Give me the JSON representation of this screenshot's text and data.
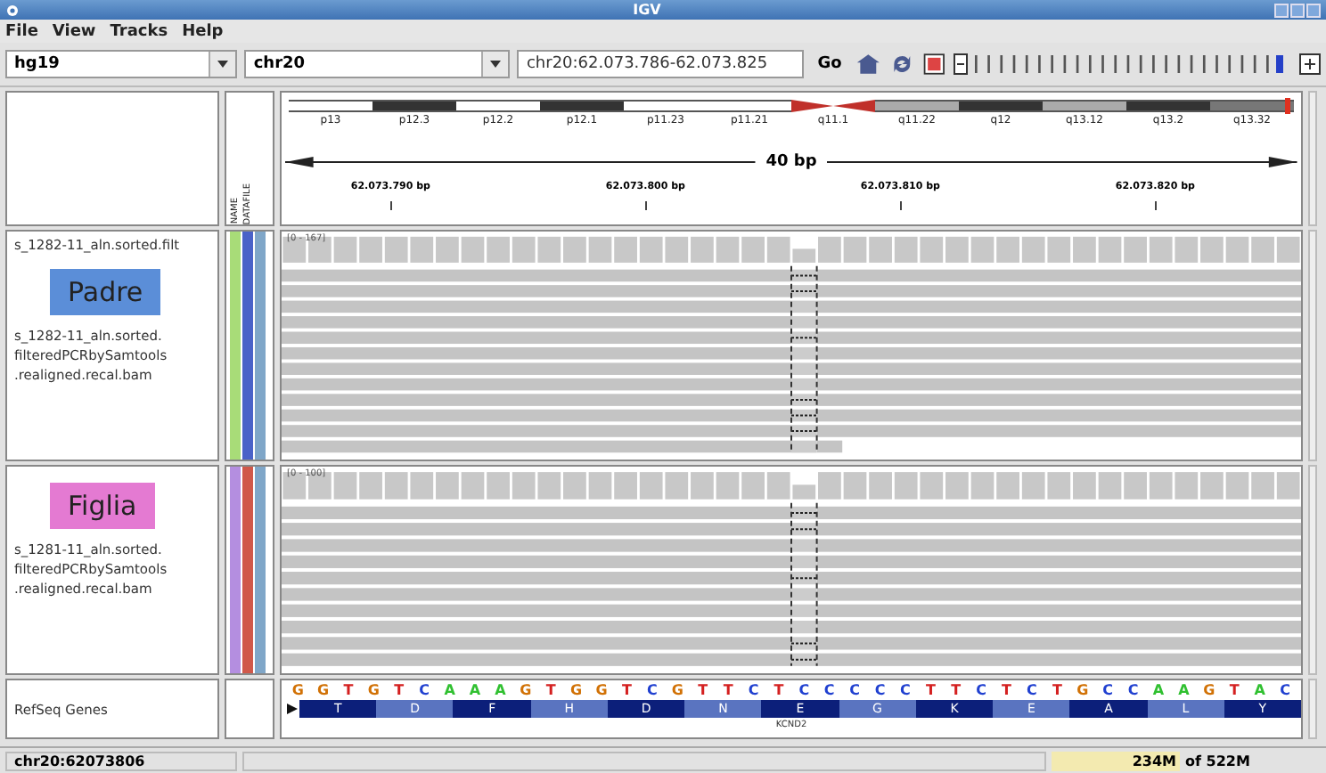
{
  "window": {
    "title": "IGV"
  },
  "menu": [
    "File",
    "View",
    "Tracks",
    "Help"
  ],
  "toolbar": {
    "genome": "hg19",
    "chromosome": "chr20",
    "locus": "chr20:62.073.786-62.073.825",
    "go": "Go",
    "zoom": {
      "level": 0.97
    }
  },
  "ideogram": {
    "bands": [
      {
        "label": "p13",
        "kind": "light"
      },
      {
        "label": "p12.3",
        "kind": "dark"
      },
      {
        "label": "p12.2",
        "kind": "light"
      },
      {
        "label": "p12.1",
        "kind": "dark"
      },
      {
        "label": "p11.23",
        "kind": "light"
      },
      {
        "label": "p11.21",
        "kind": "light"
      },
      {
        "label": "q11.1",
        "kind": "centromere"
      },
      {
        "label": "q11.22",
        "kind": "grey"
      },
      {
        "label": "q12",
        "kind": "dark"
      },
      {
        "label": "q13.12",
        "kind": "grey"
      },
      {
        "label": "q13.2",
        "kind": "dark"
      },
      {
        "label": "q13.32",
        "kind": "mid"
      }
    ]
  },
  "ruler": {
    "span": "40 bp",
    "ticks": [
      "62.073.790 bp",
      "62.073.800 bp",
      "62.073.810 bp",
      "62.073.820 bp"
    ]
  },
  "attribute_headers": [
    "NAME",
    "DATAFILE"
  ],
  "tracks": [
    {
      "name": "s_1282-11_aln.sorted.filt",
      "sample": "Padre",
      "color": "#5b8ed8",
      "file": [
        "s_1282-11_aln.sorted.",
        "filteredPCRbySamtools",
        ".realigned.recal.bam"
      ],
      "range": "[0 - 167]",
      "attributes": [
        {
          "color": "#a8dc78"
        },
        {
          "color": "#4a62c8"
        },
        {
          "color": "#7fa6c8"
        }
      ]
    },
    {
      "sample": "Figlia",
      "color": "#e47ad2",
      "file": [
        "s_1281-11_aln.sorted.",
        "filteredPCRbySamtools",
        ".realigned.recal.bam"
      ],
      "range": "[0 - 100]",
      "attributes": [
        {
          "color": "#b48ee0"
        },
        {
          "color": "#d0584a"
        },
        {
          "color": "#7fa6c8"
        }
      ]
    }
  ],
  "refseq": {
    "name": "RefSeq Genes",
    "gene": "KCND2",
    "sequence": [
      {
        "base": "G",
        "color": "#d17105"
      },
      {
        "base": "G",
        "color": "#d17105"
      },
      {
        "base": "T",
        "color": "#d42020"
      },
      {
        "base": "G",
        "color": "#d17105"
      },
      {
        "base": "T",
        "color": "#d42020"
      },
      {
        "base": "C",
        "color": "#2040d0"
      },
      {
        "base": "A",
        "color": "#30c030"
      },
      {
        "base": "A",
        "color": "#30c030"
      },
      {
        "base": "A",
        "color": "#30c030"
      },
      {
        "base": "G",
        "color": "#d17105"
      },
      {
        "base": "T",
        "color": "#d42020"
      },
      {
        "base": "G",
        "color": "#d17105"
      },
      {
        "base": "G",
        "color": "#d17105"
      },
      {
        "base": "T",
        "color": "#d42020"
      },
      {
        "base": "C",
        "color": "#2040d0"
      },
      {
        "base": "G",
        "color": "#d17105"
      },
      {
        "base": "T",
        "color": "#d42020"
      },
      {
        "base": "T",
        "color": "#d42020"
      },
      {
        "base": "C",
        "color": "#2040d0"
      },
      {
        "base": "T",
        "color": "#d42020"
      },
      {
        "base": "C",
        "color": "#2040d0"
      },
      {
        "base": "C",
        "color": "#2040d0"
      },
      {
        "base": "C",
        "color": "#2040d0"
      },
      {
        "base": "C",
        "color": "#2040d0"
      },
      {
        "base": "C",
        "color": "#2040d0"
      },
      {
        "base": "T",
        "color": "#d42020"
      },
      {
        "base": "T",
        "color": "#d42020"
      },
      {
        "base": "C",
        "color": "#2040d0"
      },
      {
        "base": "T",
        "color": "#d42020"
      },
      {
        "base": "C",
        "color": "#2040d0"
      },
      {
        "base": "T",
        "color": "#d42020"
      },
      {
        "base": "G",
        "color": "#d17105"
      },
      {
        "base": "C",
        "color": "#2040d0"
      },
      {
        "base": "C",
        "color": "#2040d0"
      },
      {
        "base": "A",
        "color": "#30c030"
      },
      {
        "base": "A",
        "color": "#30c030"
      },
      {
        "base": "G",
        "color": "#d17105"
      },
      {
        "base": "T",
        "color": "#d42020"
      },
      {
        "base": "A",
        "color": "#30c030"
      },
      {
        "base": "C",
        "color": "#2040d0"
      }
    ],
    "amino_acids": [
      "T",
      "D",
      "F",
      "H",
      "D",
      "N",
      "E",
      "G",
      "K",
      "E",
      "A",
      "L",
      "Y"
    ]
  },
  "status_bar": {
    "position": "chr20:62073806",
    "memory_used": "234M",
    "memory_total": "of 522M"
  }
}
